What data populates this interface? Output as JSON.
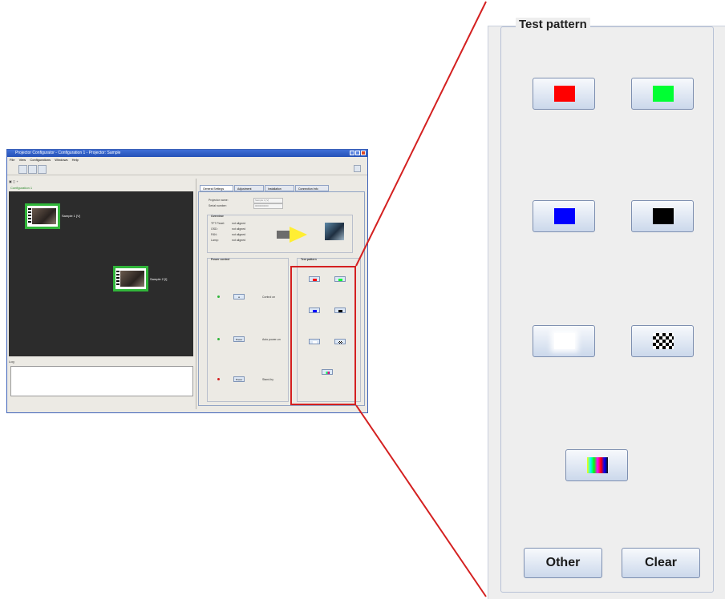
{
  "window": {
    "title": "Projector Configurator - Configuration 1 - Projector: Sample",
    "menu": [
      "File",
      "View",
      "Configurations",
      "Windows",
      "Help"
    ],
    "left_pane_label": "Configuration 1",
    "projectors": [
      {
        "label": "Sample 1 [V]"
      },
      {
        "label": "Sample 2 [I]"
      }
    ],
    "log_label": "Log",
    "tabs": [
      "General Settings",
      "Adjustment",
      "Installation",
      "Connection Info"
    ],
    "info": {
      "name_label": "Projector name:",
      "name_value": "Sample 1 [V]",
      "serial_label": "Serial number:",
      "serial_value": "0000000000",
      "status_title": "Overview",
      "status_rows": [
        {
          "label": "TFT Panel:",
          "value": "not aligned"
        },
        {
          "label": "OSD:",
          "value": "not aligned"
        },
        {
          "label": "FAN:",
          "value": "not aligned"
        },
        {
          "label": "Lamp:",
          "value": "not aligned"
        }
      ]
    },
    "power_title": "Power control",
    "power_rows": [
      {
        "button": "●",
        "label": "Control on",
        "dot_color": "#2fb53a"
      },
      {
        "button": "Power",
        "label": "Auto power-on",
        "dot_color": "#2fb53a"
      },
      {
        "button": "Power",
        "label": "Stand-by",
        "dot_color": "#d42020"
      }
    ],
    "mini_test_title": "Test pattern"
  },
  "test_pattern": {
    "title": "Test pattern",
    "patterns": [
      {
        "name": "red",
        "color": "#ff0000"
      },
      {
        "name": "green",
        "color": "#00ff33"
      },
      {
        "name": "blue",
        "color": "#0000ff"
      },
      {
        "name": "black",
        "color": "#000000"
      },
      {
        "name": "white",
        "color": "#ffffff"
      },
      {
        "name": "checkerboard",
        "color": "#000000"
      },
      {
        "name": "color-bars",
        "color": "#8a2be2"
      }
    ],
    "other_label": "Other",
    "clear_label": "Clear"
  },
  "accent_colors": {
    "highlight": "#d42020",
    "selection": "#31b63a"
  }
}
